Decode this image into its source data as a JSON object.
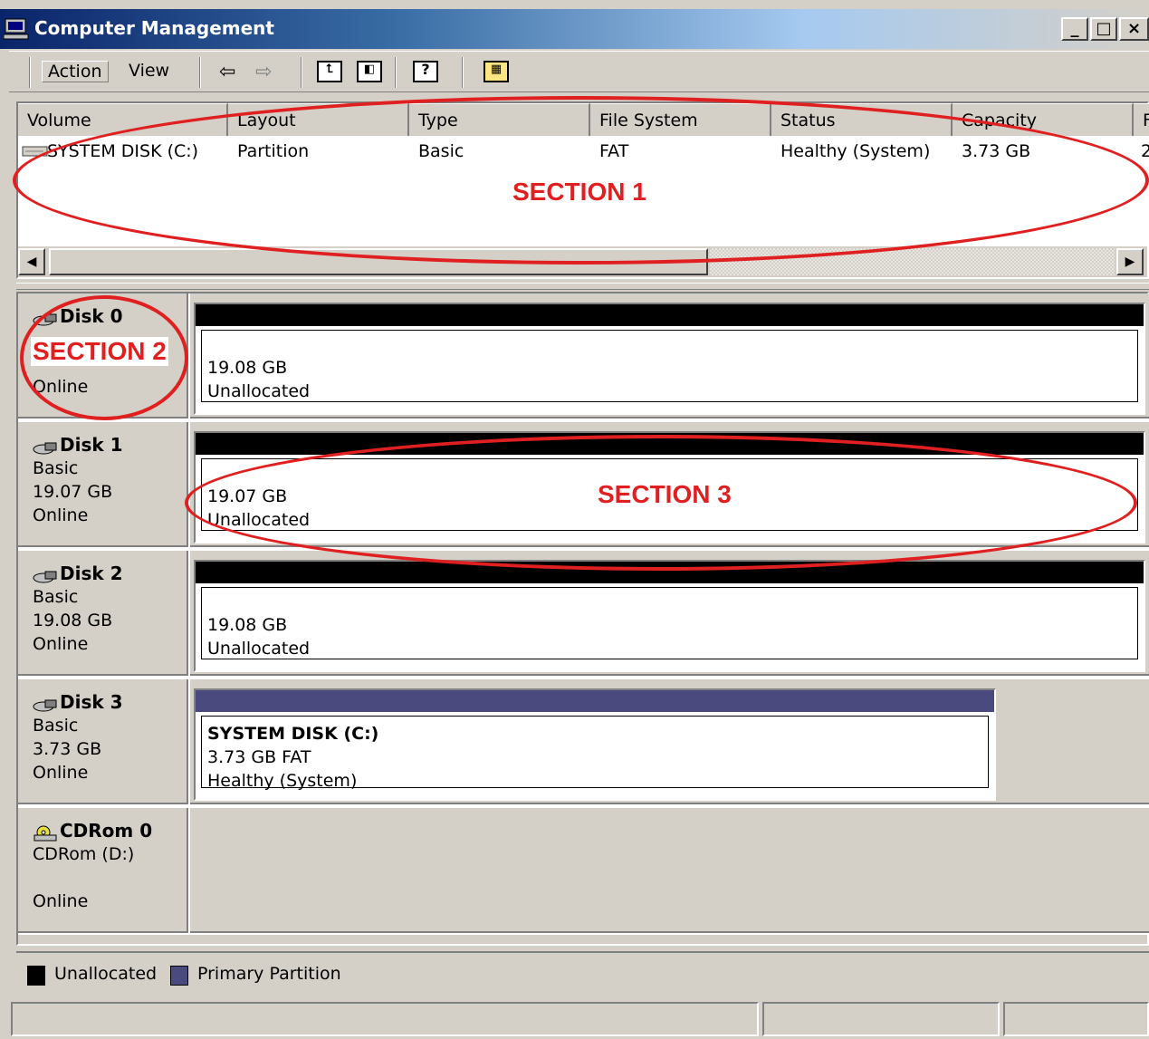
{
  "window": {
    "title": "Computer Management",
    "controls": [
      "_",
      "□",
      "×"
    ]
  },
  "toolbar": {
    "menus": [
      "Action",
      "View"
    ],
    "icons": [
      "back-arrow-icon",
      "forward-arrow-icon",
      "up-folder-icon",
      "show-hide-tree-icon",
      "help-icon",
      "properties-icon"
    ]
  },
  "volume_list": {
    "columns": [
      "Volume",
      "Layout",
      "Type",
      "File System",
      "Status",
      "Capacity",
      "F"
    ],
    "rows": [
      {
        "volume": "SYSTEM DISK (C:)",
        "layout": "Partition",
        "type": "Basic",
        "file_system": "FAT",
        "status": "Healthy (System)",
        "capacity": "3.73 GB",
        "extra": "2"
      }
    ]
  },
  "disks": [
    {
      "name": "Disk 0",
      "type": "",
      "size": "",
      "status": "Online",
      "partition": {
        "size": "19.08 GB",
        "label": "",
        "line2": "Unallocated",
        "kind": "unallocated",
        "fraction": 1.0
      }
    },
    {
      "name": "Disk 1",
      "type": "Basic",
      "size": "19.07 GB",
      "status": "Online",
      "partition": {
        "size": "19.07 GB",
        "label": "",
        "line2": "Unallocated",
        "kind": "unallocated",
        "fraction": 1.0
      }
    },
    {
      "name": "Disk 2",
      "type": "Basic",
      "size": "19.08 GB",
      "status": "Online",
      "partition": {
        "size": "19.08 GB",
        "label": "",
        "line2": "Unallocated",
        "kind": "unallocated",
        "fraction": 1.0
      }
    },
    {
      "name": "Disk 3",
      "type": "Basic",
      "size": "3.73 GB",
      "status": "Online",
      "partition": {
        "label": "SYSTEM DISK  (C:)",
        "size": "3.73 GB FAT",
        "line2": "Healthy (System)",
        "kind": "primary",
        "fraction": 0.84
      }
    },
    {
      "name": "CDRom 0",
      "type": "CDRom (D:)",
      "size": "",
      "status": "Online"
    }
  ],
  "legend": [
    {
      "label": "Unallocated",
      "color": "#000000"
    },
    {
      "label": "Primary Partition",
      "color": "#4b4a7e"
    }
  ],
  "annotations": [
    "SECTION 1",
    "SECTION 2",
    "SECTION 3"
  ],
  "colors": {
    "accent_annotation": "#e02020",
    "title_gradient_start": "#0a246a"
  }
}
